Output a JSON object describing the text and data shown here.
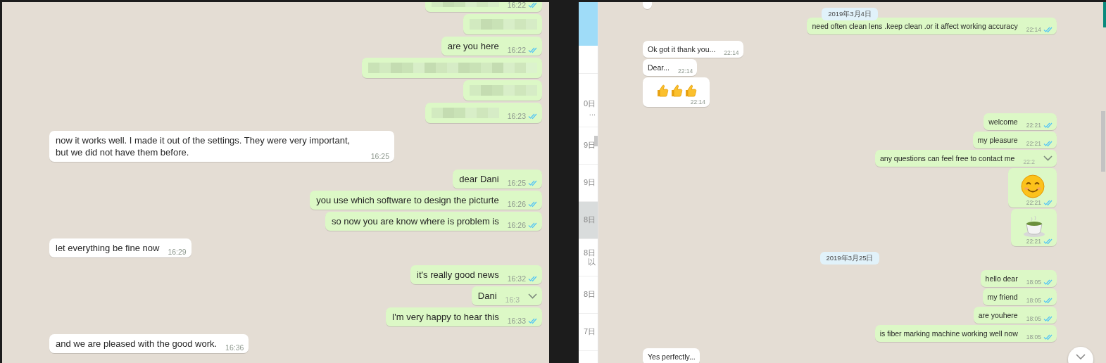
{
  "left_chat": {
    "messages": [
      {
        "kind": "blurred",
        "outgoing": true,
        "time": "16:22",
        "read": true
      },
      {
        "kind": "blurred",
        "outgoing": true
      },
      {
        "kind": "text",
        "outgoing": true,
        "text": "are you here",
        "time": "16:22",
        "read": true
      },
      {
        "kind": "blurred-wide",
        "outgoing": true
      },
      {
        "kind": "blurred",
        "outgoing": true
      },
      {
        "kind": "blurred",
        "outgoing": true,
        "time": "16:23",
        "read": true
      },
      {
        "kind": "text",
        "outgoing": false,
        "text": "now it works well. I made it out of the settings. They were very important, but we did not have them before.",
        "time": "16:25"
      },
      {
        "kind": "text",
        "outgoing": true,
        "text": "dear Dani",
        "time": "16:25",
        "read": true
      },
      {
        "kind": "text",
        "outgoing": true,
        "text": "you use which software to design the picturte",
        "time": "16:26",
        "read": true
      },
      {
        "kind": "text",
        "outgoing": true,
        "text": "so now you are know where is problem is",
        "time": "16:26",
        "read": true
      },
      {
        "kind": "text",
        "outgoing": false,
        "text": "let everything be fine now",
        "time": "16:29"
      },
      {
        "kind": "text",
        "outgoing": true,
        "text": "it's really good news",
        "time": "16:32",
        "read": true
      },
      {
        "kind": "text",
        "outgoing": true,
        "text": "Dani",
        "time": "16:3",
        "menu_open": true
      },
      {
        "kind": "text",
        "outgoing": true,
        "text": "I'm very happy to hear this",
        "time": "16:33",
        "read": true
      },
      {
        "kind": "text",
        "outgoing": false,
        "text": "and we are pleased with the good work.",
        "time": "16:36"
      }
    ]
  },
  "right_chat": {
    "sidebar": {
      "items": [
        {
          "label": "0日",
          "preview": "...",
          "selected": false
        },
        {
          "label": "9日",
          "selected": false
        },
        {
          "label": "9日",
          "selected": false
        },
        {
          "label": "8日",
          "selected": true
        },
        {
          "label": "8日",
          "preview": "以",
          "selected": false
        },
        {
          "label": "8日",
          "selected": false
        },
        {
          "label": "7日",
          "selected": false
        }
      ]
    },
    "messages": [
      {
        "kind": "text",
        "outgoing": false
      },
      {
        "kind": "date",
        "text": "2019年3月4日"
      },
      {
        "kind": "text",
        "outgoing": true,
        "text": "need often clean lens .keep clean .or it affect working accuracy",
        "time": "22:14",
        "read": true
      },
      {
        "kind": "text",
        "outgoing": false,
        "text": "Ok got it thank you...",
        "time": "22:14"
      },
      {
        "kind": "text",
        "outgoing": false,
        "text": "Dear...",
        "time": "22:14"
      },
      {
        "kind": "thumbs-up",
        "outgoing": false,
        "time": "22:14"
      },
      {
        "kind": "text",
        "outgoing": true,
        "text": "welcome",
        "time": "22:21",
        "read": true
      },
      {
        "kind": "text",
        "outgoing": true,
        "text": "my pleasure",
        "time": "22:21",
        "read": true
      },
      {
        "kind": "text",
        "outgoing": true,
        "text": "any questions can feel free to contact me",
        "time": "22:2",
        "menu_open": true
      },
      {
        "kind": "smiley",
        "outgoing": true,
        "time": "22:21",
        "read": true
      },
      {
        "kind": "teacup",
        "outgoing": true,
        "time": "22:21",
        "read": true
      },
      {
        "kind": "date",
        "text": "2019年3月25日"
      },
      {
        "kind": "text",
        "outgoing": true,
        "text": "hello dear",
        "time": "18:05",
        "read": true
      },
      {
        "kind": "text",
        "outgoing": true,
        "text": "my friend",
        "time": "18:05",
        "read": true
      },
      {
        "kind": "text",
        "outgoing": true,
        "text": "are youhere",
        "time": "18:05",
        "read": true
      },
      {
        "kind": "text",
        "outgoing": true,
        "text": "is fiber marking machine working well now",
        "time": "18:05",
        "read": true
      },
      {
        "kind": "text",
        "outgoing": false,
        "text": "Yes perfectly..."
      }
    ]
  }
}
